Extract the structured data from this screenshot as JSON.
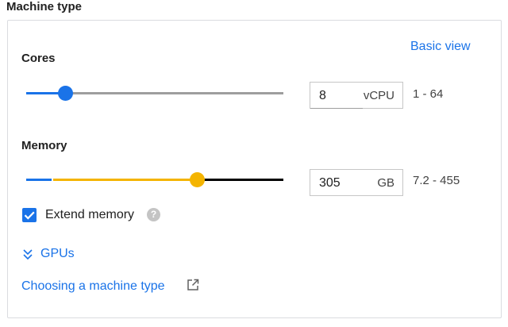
{
  "section": {
    "title": "Machine type"
  },
  "panel": {
    "basic_view_link": "Basic view",
    "cores": {
      "label": "Cores",
      "value": "8",
      "unit": "vCPU",
      "range": "1 - 64",
      "min": 1,
      "max": 64,
      "slider_fraction": 0.15,
      "colors": {
        "fill": "#1a73e8",
        "track": "#9e9e9e",
        "thumb": "#1a73e8"
      }
    },
    "memory": {
      "label": "Memory",
      "value": "305",
      "unit": "GB",
      "range": "7.2 - 455",
      "min": 7.2,
      "max": 455,
      "slider_fraction": 0.665,
      "colors": {
        "base": "#1a73e8",
        "extended": "#f4b400",
        "beyond": "#000000",
        "thumb": "#f4b400"
      }
    },
    "extend_memory": {
      "label": "Extend memory",
      "checked": true,
      "help_icon": "help-icon"
    },
    "gpus_toggle": {
      "label": "GPUs",
      "icon": "chevron-double-down-icon"
    },
    "help_link": {
      "label": "Choosing a machine type",
      "icon": "external-link-icon"
    }
  }
}
